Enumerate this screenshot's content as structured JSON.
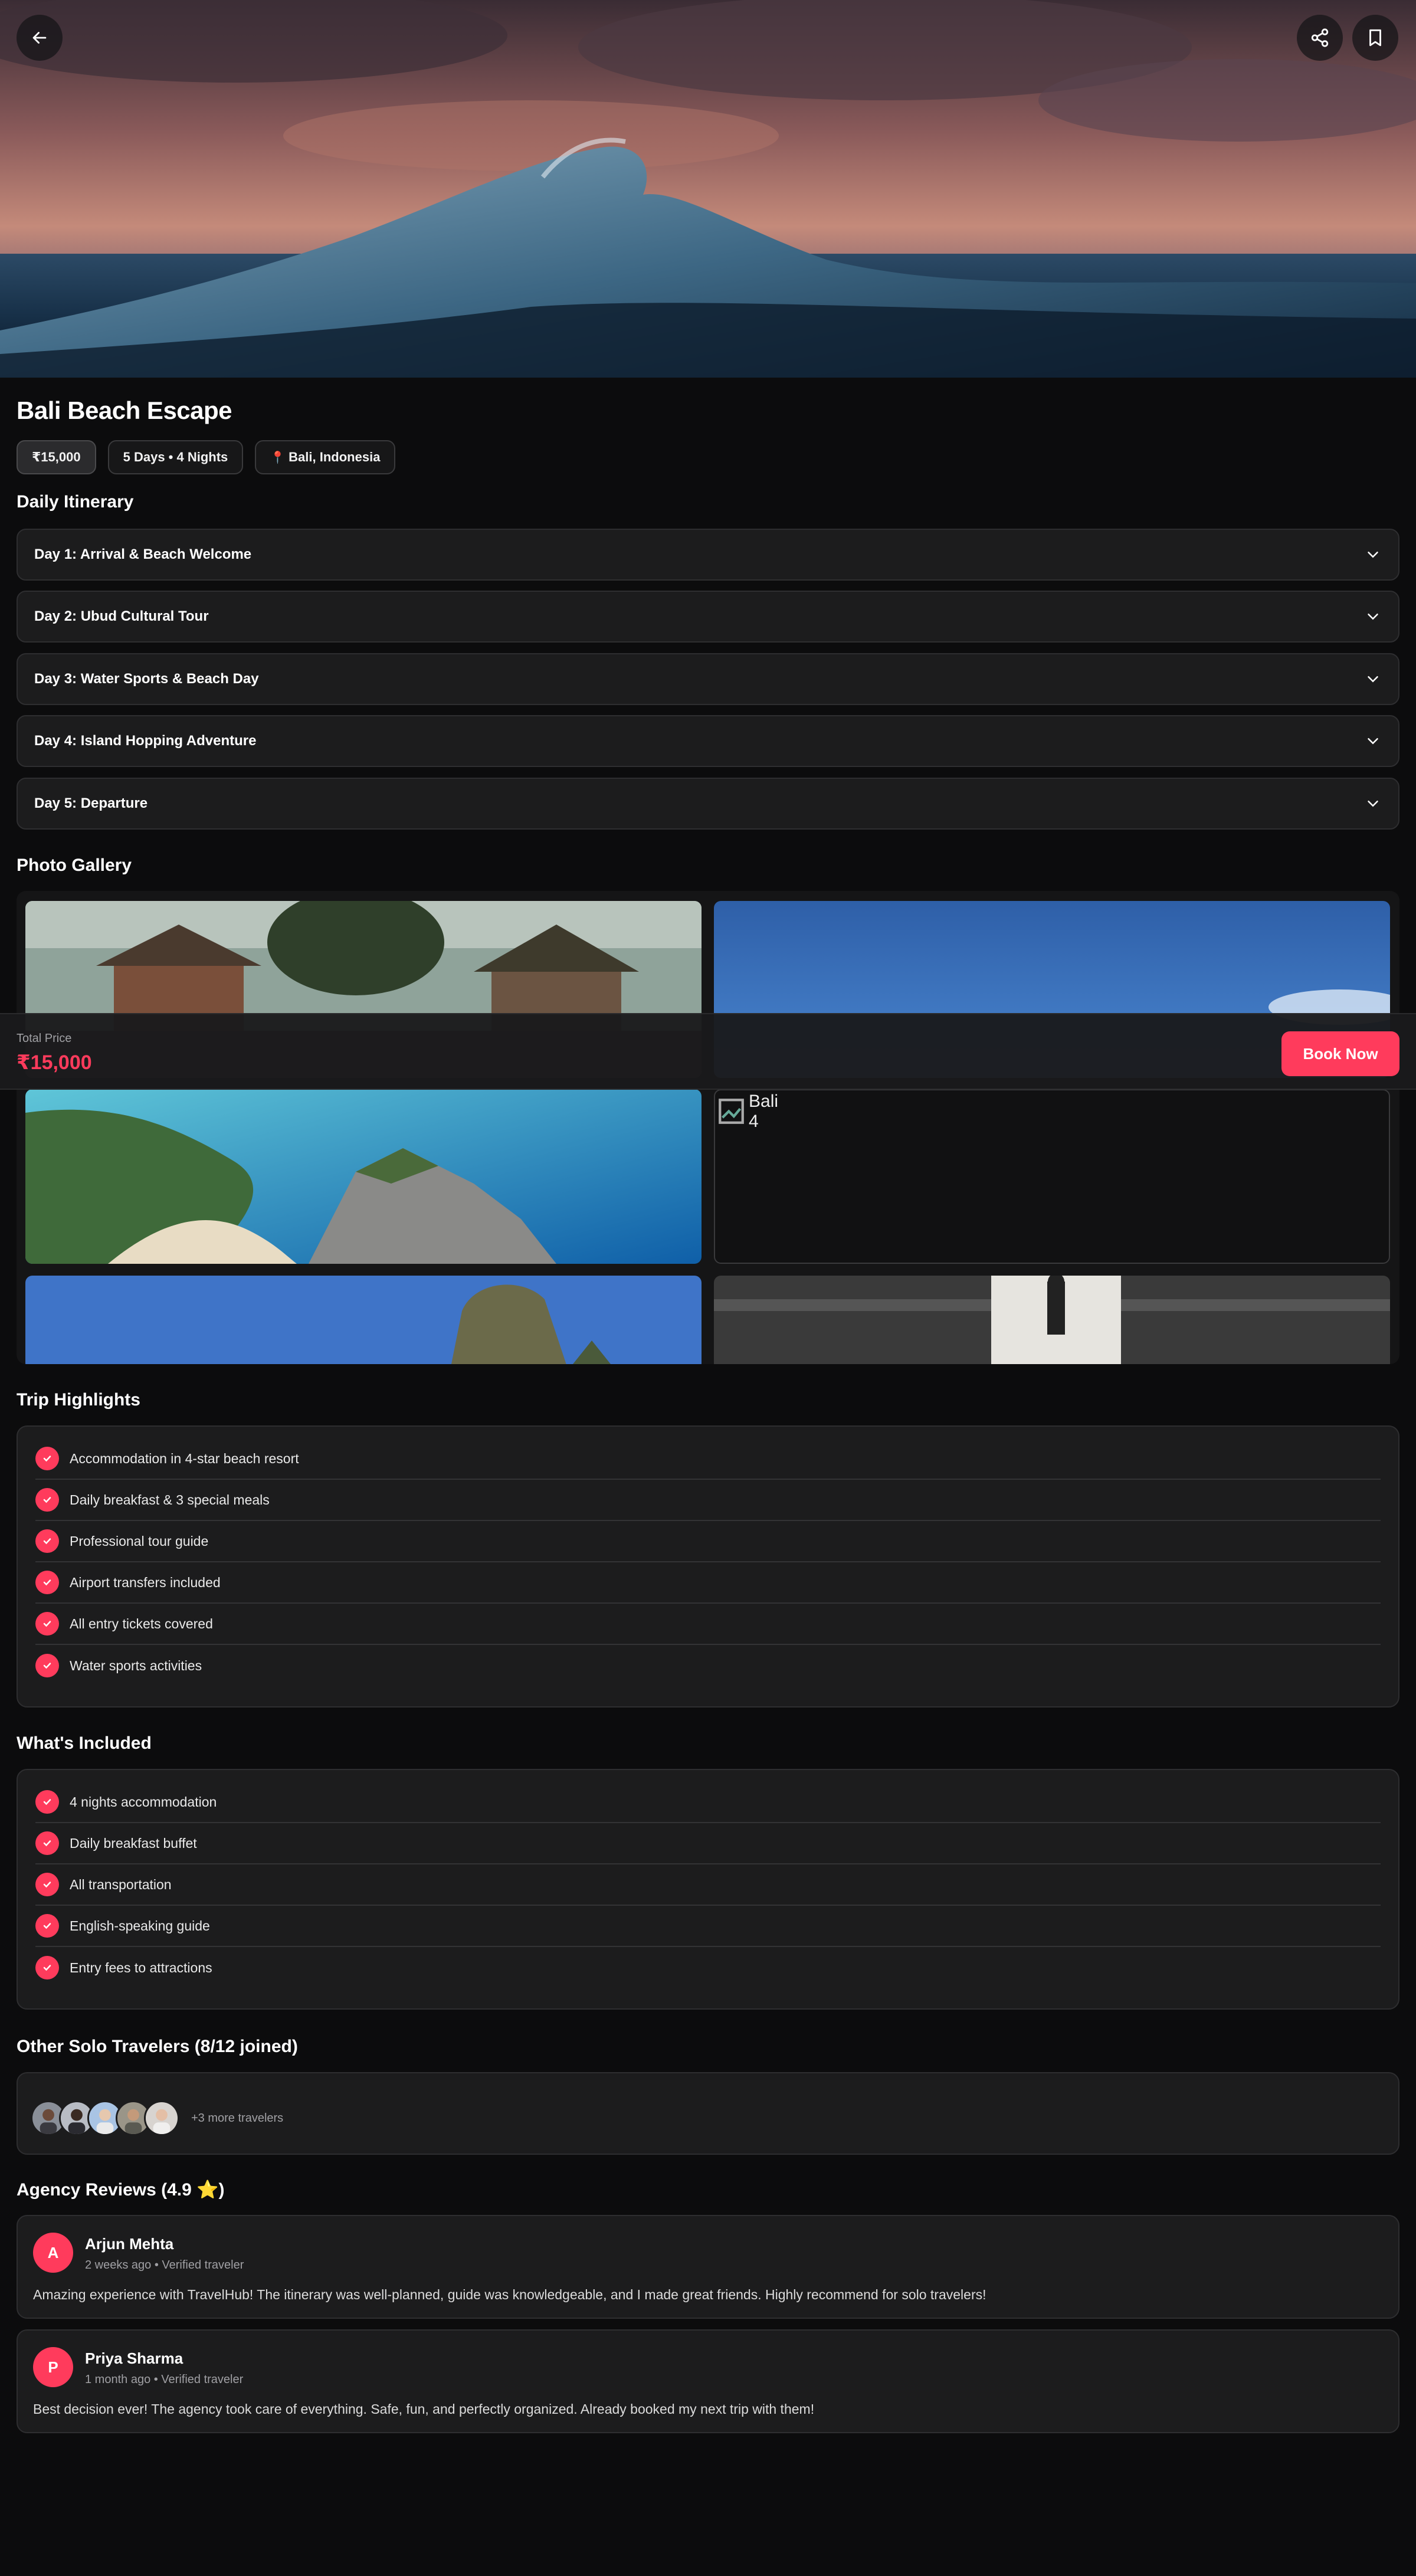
{
  "header": {
    "back_icon": "arrow-left-icon",
    "share_icon": "share-icon",
    "bookmark_icon": "bookmark-icon"
  },
  "trip": {
    "title": "Bali Beach Escape",
    "price_chip": "₹15,000",
    "duration_chip": "5 Days • 4 Nights",
    "location_chip": "Bali, Indonesia",
    "location_icon": "map-pin-icon"
  },
  "itinerary": {
    "title": "Daily Itinerary",
    "days": [
      {
        "label": "Day 1: Arrival & Beach Welcome"
      },
      {
        "label": "Day 2: Ubud Cultural Tour"
      },
      {
        "label": "Day 3: Water Sports & Beach Day"
      },
      {
        "label": "Day 4: Island Hopping Adventure"
      },
      {
        "label": "Day 5: Departure"
      }
    ]
  },
  "gallery": {
    "title": "Photo Gallery",
    "broken_image_alt": "Bali 4"
  },
  "price_bar": {
    "label": "Total Price",
    "value": "₹15,000",
    "book_label": "Book Now"
  },
  "highlights": {
    "title": "Trip Highlights",
    "items": [
      "Accommodation in 4-star beach resort",
      "Daily breakfast & 3 special meals",
      "Professional tour guide",
      "Airport transfers included",
      "All entry tickets covered",
      "Water sports activities"
    ]
  },
  "included": {
    "title": "What's Included",
    "items": [
      "4 nights accommodation",
      "Daily breakfast buffet",
      "All transportation",
      "English-speaking guide",
      "Entry fees to attractions"
    ]
  },
  "travelers": {
    "title": "Other Solo Travelers (8/12 joined)",
    "more": "+3 more travelers"
  },
  "reviews": {
    "title": "Agency Reviews (4.9 ⭐)",
    "items": [
      {
        "initial": "A",
        "name": "Arjun Mehta",
        "meta": "2 weeks ago • Verified traveler",
        "text": "Amazing experience with TravelHub! The itinerary was well-planned, guide was knowledgeable, and I made great friends. Highly recommend for solo travelers!"
      },
      {
        "initial": "P",
        "name": "Priya Sharma",
        "meta": "1 month ago • Verified traveler",
        "text": "Best decision ever! The agency took care of everything. Safe, fun, and perfectly organized. Already booked my next trip with them!"
      }
    ]
  },
  "colors": {
    "accent": "#ff3b5c",
    "background": "#0c0c0d",
    "card": "#1c1c1d"
  }
}
